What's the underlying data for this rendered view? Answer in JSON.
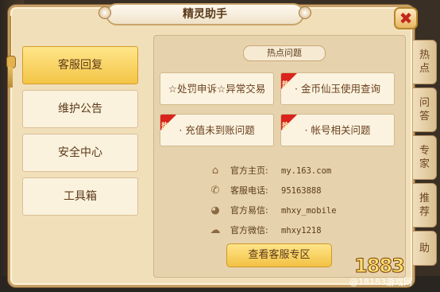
{
  "window": {
    "title": "精灵助手",
    "close_symbol": "✖"
  },
  "nav": {
    "items": [
      {
        "label": "客服回复",
        "active": true
      },
      {
        "label": "维护公告",
        "active": false
      },
      {
        "label": "安全中心",
        "active": false
      },
      {
        "label": "工具箱",
        "active": false
      }
    ]
  },
  "hot": {
    "title": "热点问题",
    "badge": "热",
    "questions": [
      {
        "label": "☆处罚申诉☆异常交易",
        "hot": false
      },
      {
        "label": "· 金币仙玉使用查询",
        "hot": true
      },
      {
        "label": "· 充值未到账问题",
        "hot": true
      },
      {
        "label": "· 帐号相关问题",
        "hot": true
      }
    ]
  },
  "contact": [
    {
      "icon": "home-icon",
      "glyph": "⌂",
      "label": "官方主页:",
      "value": "my.163.com"
    },
    {
      "icon": "phone-icon",
      "glyph": "✆",
      "label": "客服电话:",
      "value": "95163888"
    },
    {
      "icon": "yixin-icon",
      "glyph": "◕",
      "label": "官方易信:",
      "value": "mhxy_mobile"
    },
    {
      "icon": "wechat-icon",
      "glyph": "☁",
      "label": "官方微信:",
      "value": "mhxy1218"
    }
  ],
  "service_button": "查看客服专区",
  "side_tabs": [
    "热点",
    "问答",
    "专家",
    "推荐",
    "助"
  ],
  "watermark": {
    "logo": "1883",
    "text": "@18183游戏网"
  },
  "colors": {
    "accent": "#f3c445",
    "hot": "#d8241c",
    "panel": "#f1dfb9"
  }
}
